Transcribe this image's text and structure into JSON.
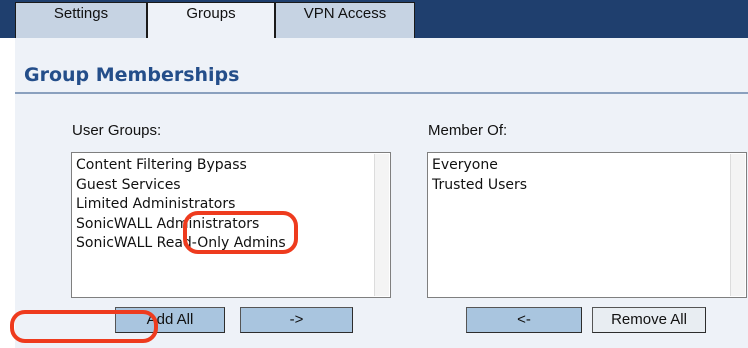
{
  "tabs": [
    {
      "label": "Settings"
    },
    {
      "label": "Groups"
    },
    {
      "label": "VPN Access"
    }
  ],
  "section": {
    "title": "Group Memberships"
  },
  "user_groups": {
    "label": "User Groups:",
    "items": [
      "Content Filtering Bypass",
      "Guest Services",
      "Limited Administrators",
      "SonicWALL Administrators",
      "SonicWALL Read-Only Admins"
    ]
  },
  "member_of": {
    "label": "Member Of:",
    "items": [
      "Everyone",
      "Trusted Users"
    ]
  },
  "buttons": {
    "add_all": "Add All",
    "add": "->",
    "remove": "<-",
    "remove_all": "Remove All"
  },
  "colors": {
    "tabbar": "#1f3f6e",
    "panel": "#eef2f8",
    "title": "#244e8a",
    "button": "#a9c5df",
    "annotation": "#ee3b1e"
  }
}
